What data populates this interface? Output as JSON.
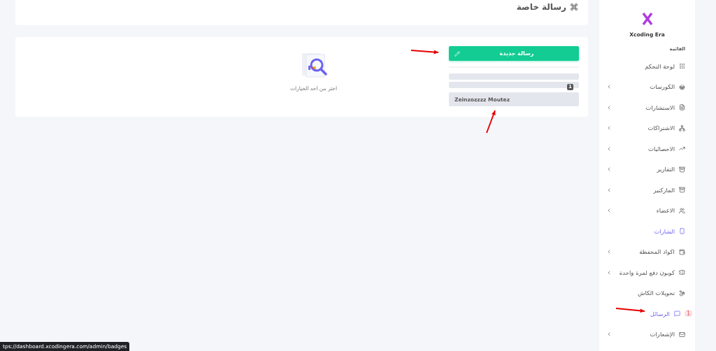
{
  "header": {
    "title": "رسالة خاصة"
  },
  "messages_panel": {
    "new_button": "رسالة جديدة",
    "count_badge": "1",
    "conversations": [
      {
        "name": "Zeinzozzzz Moutez",
        "selected": false
      }
    ],
    "empty_state": "اختر من احد الخيارات"
  },
  "sidebar": {
    "brand": "Xcoding Era",
    "section": "القائمة",
    "items": [
      {
        "label": "لوحة التحكم",
        "chevron": false,
        "selected": false
      },
      {
        "label": "الكورسات",
        "chevron": true,
        "selected": false
      },
      {
        "label": "الاستشارات",
        "chevron": true,
        "selected": false
      },
      {
        "label": "الاشتراكات",
        "chevron": true,
        "selected": false
      },
      {
        "label": "الاحصائيات",
        "chevron": true,
        "selected": false
      },
      {
        "label": "التقارير",
        "chevron": true,
        "selected": false
      },
      {
        "label": "الماركتير",
        "chevron": true,
        "selected": false
      },
      {
        "label": "الاعضاء",
        "chevron": true,
        "selected": false
      },
      {
        "label": "الشارات",
        "chevron": false,
        "selected": true
      },
      {
        "label": "اكواد المحفظة",
        "chevron": true,
        "selected": false
      },
      {
        "label": "كوبون دفع لمرة واحدة",
        "chevron": true,
        "selected": false
      },
      {
        "label": "تحويلات الكاش",
        "chevron": false,
        "selected": false
      },
      {
        "label": "الرسائل",
        "chevron": false,
        "selected": true,
        "badge": "1"
      },
      {
        "label": "الإشعارات",
        "chevron": true,
        "selected": false
      }
    ]
  },
  "status_link": "tps://dashboard.xcodingera.com/admin/badges"
}
